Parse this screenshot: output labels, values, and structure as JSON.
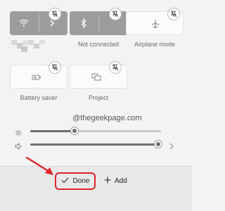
{
  "tiles": {
    "airplane_label": "Airplane mode",
    "bluetooth_label": "Not connected",
    "battery_label": "Battery saver",
    "project_label": "Project"
  },
  "watermark": "@thegeekpage.com",
  "brightness": {
    "level": 0.34
  },
  "volume": {
    "level": 0.98
  },
  "footer": {
    "done_label": "Done",
    "add_label": "Add"
  },
  "colors": {
    "tile_gray": "#9c9c9c",
    "highlight": "#e0242b"
  },
  "icons": [
    "wifi-icon",
    "chevron-right-icon",
    "bluetooth-icon",
    "airplane-icon",
    "battery-saver-icon",
    "project-icon",
    "unpin-icon",
    "brightness-icon",
    "volume-icon",
    "checkmark-icon",
    "plus-icon",
    "red-arrow"
  ]
}
